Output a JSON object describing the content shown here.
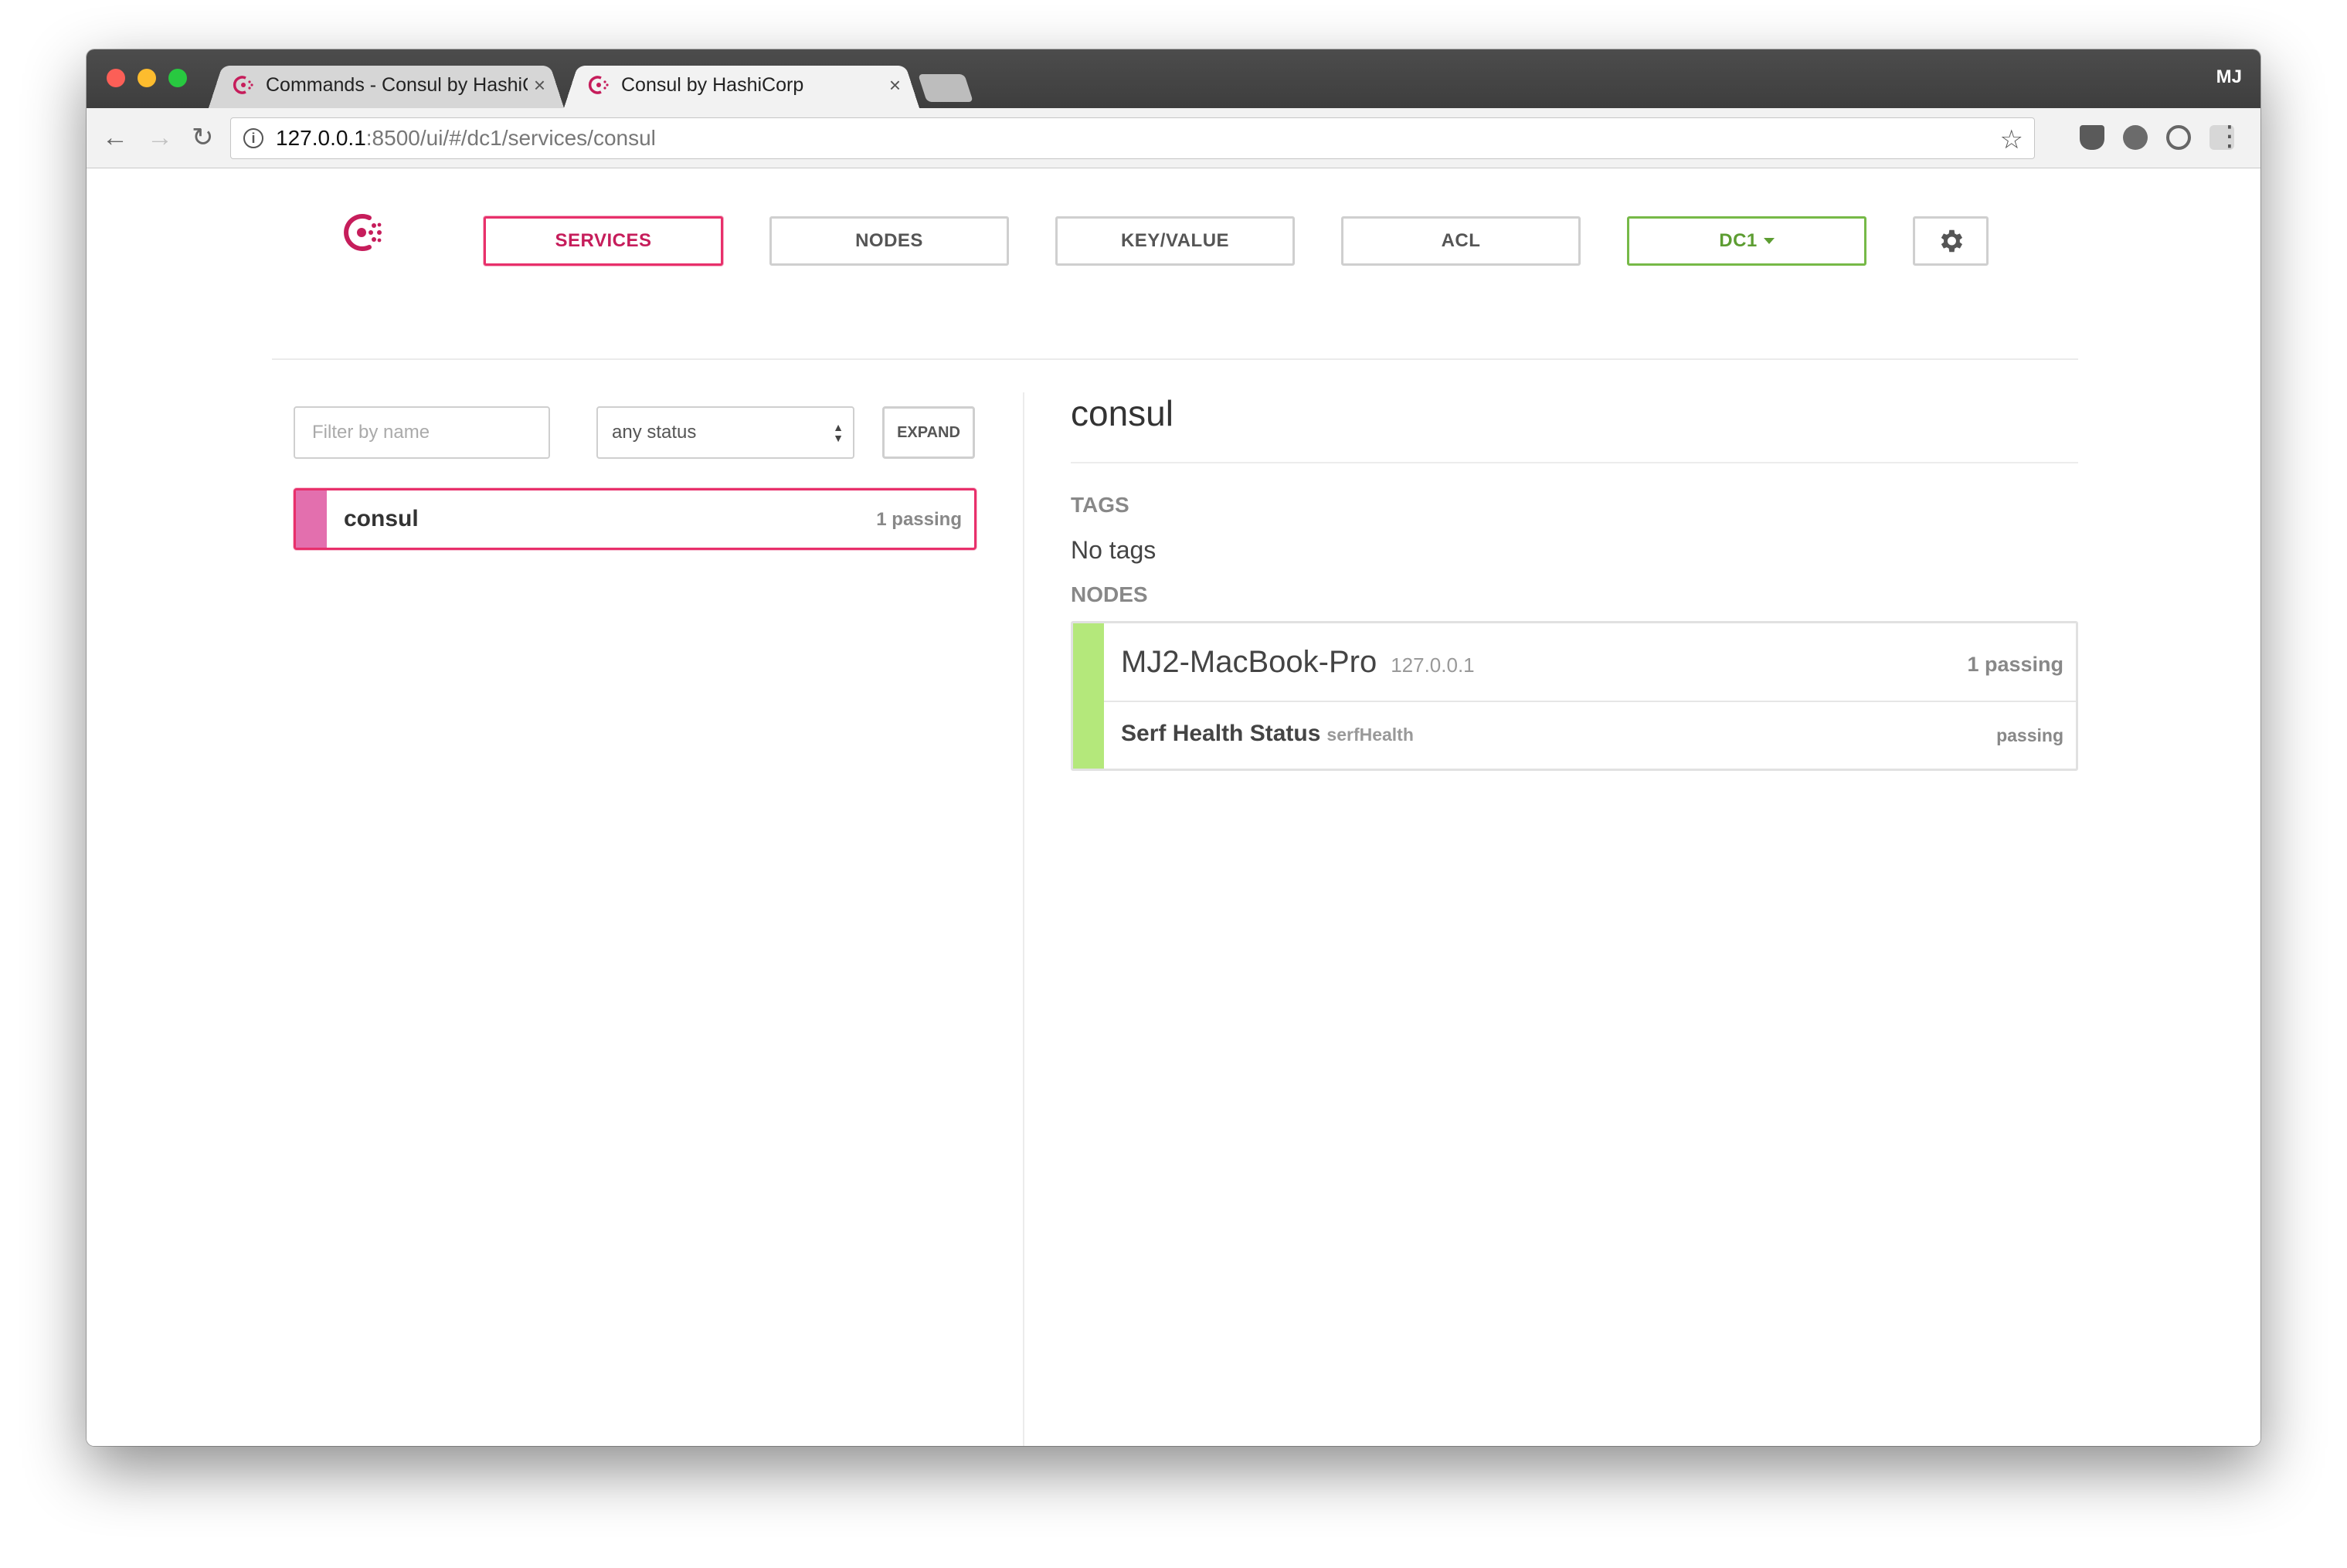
{
  "browser": {
    "tabs": [
      {
        "title": "Commands - Consul by HashiC",
        "close": "×",
        "active": false
      },
      {
        "title": "Consul by HashiCorp",
        "close": "×",
        "active": true
      }
    ],
    "profile": "MJ",
    "url_host": "127.0.0.1",
    "url_rest": ":8500/ui/#/dc1/services/consul",
    "icons": {
      "back": "←",
      "forward": "→",
      "reload": "↻",
      "star": "☆",
      "menu": "⋮",
      "info": "i"
    }
  },
  "nav": {
    "services": "SERVICES",
    "nodes": "NODES",
    "kv": "KEY/VALUE",
    "acl": "ACL",
    "dc": "DC1",
    "accent": "#e8306b",
    "dc_color": "#76b947"
  },
  "filters": {
    "name_placeholder": "Filter by name",
    "status": "any status",
    "expand": "EXPAND"
  },
  "services": [
    {
      "name": "consul",
      "count": "1 passing"
    }
  ],
  "detail": {
    "title": "consul",
    "tags_label": "TAGS",
    "tags_value": "No tags",
    "nodes_label": "NODES",
    "node": {
      "name": "MJ2-MacBook-Pro",
      "address": "127.0.0.1",
      "count": "1 passing",
      "check": {
        "name": "Serf Health Status",
        "id": "serfHealth",
        "status": "passing"
      }
    },
    "passing_color": "#b4e87b"
  }
}
